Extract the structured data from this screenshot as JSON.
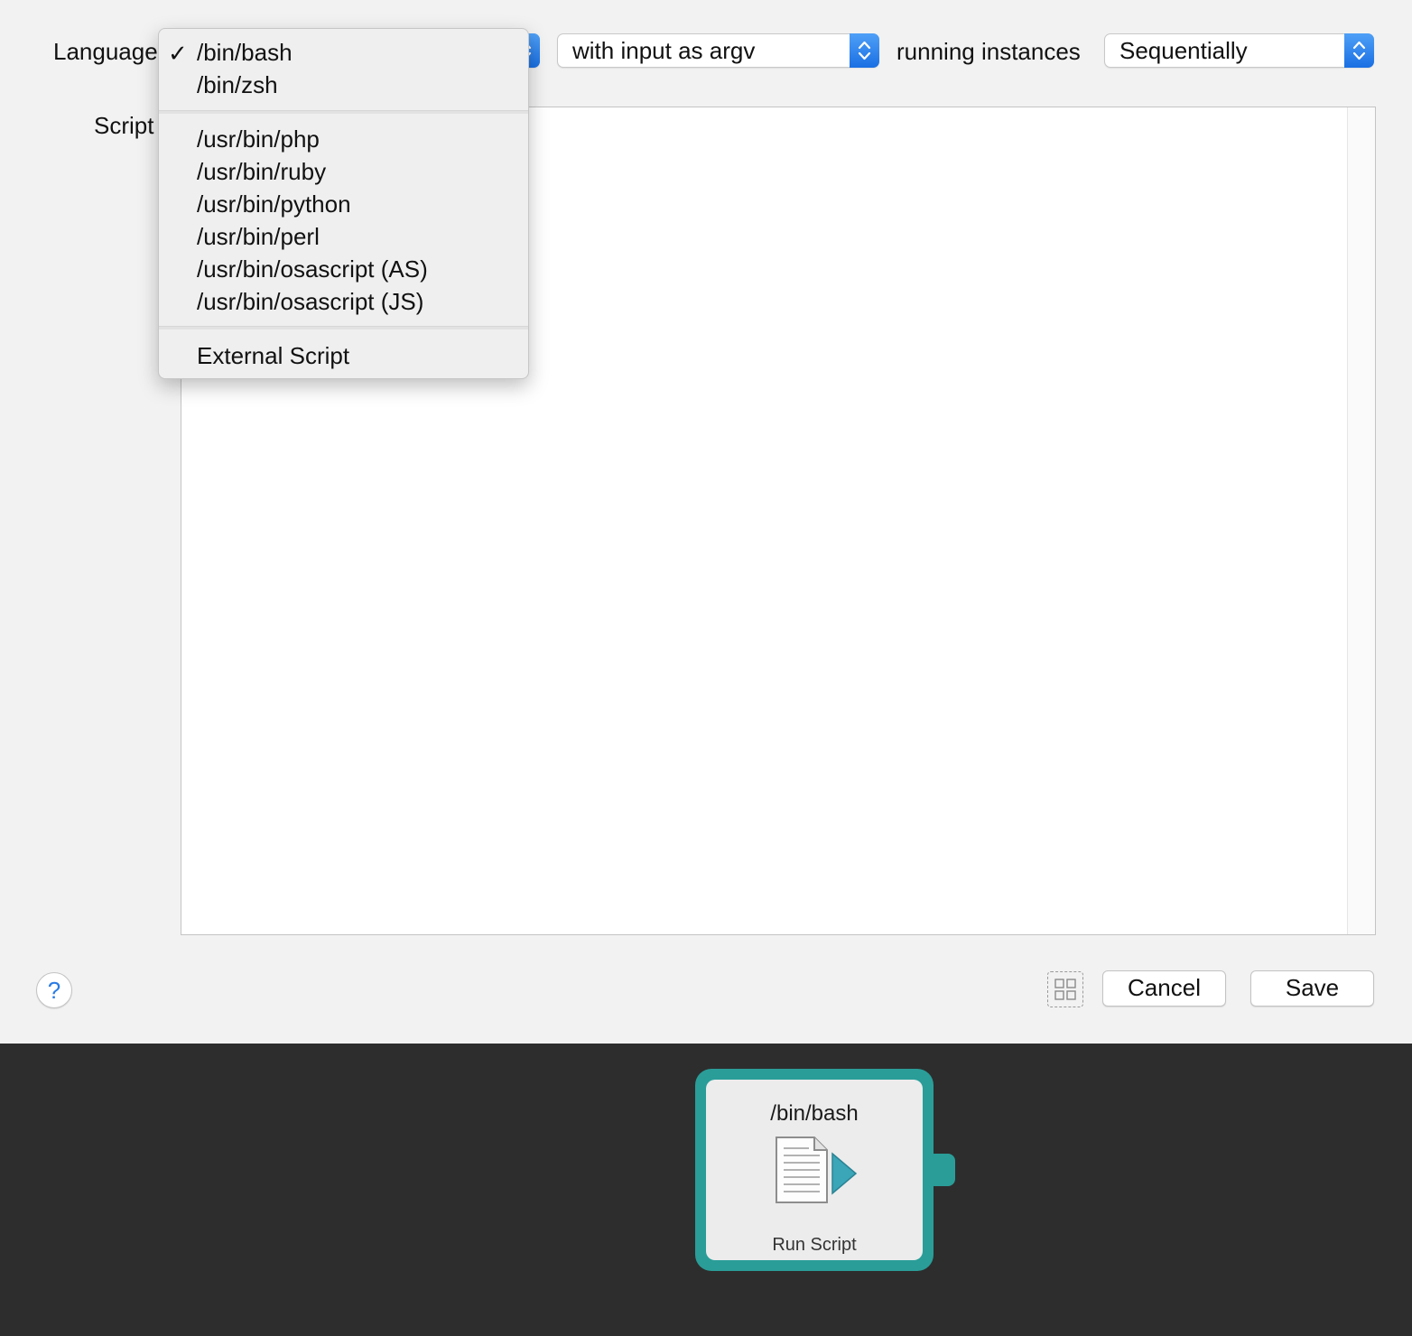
{
  "form": {
    "language_label": "Language",
    "script_label": "Script",
    "input_popup_value": "with input as argv",
    "running_label": "running instances",
    "running_popup_value": "Sequentially"
  },
  "language_menu": {
    "selected_check": "✓",
    "items": [
      "/bin/bash",
      "/bin/zsh",
      "/usr/bin/php",
      "/usr/bin/ruby",
      "/usr/bin/python",
      "/usr/bin/perl",
      "/usr/bin/osascript (AS)",
      "/usr/bin/osascript (JS)",
      "External Script"
    ]
  },
  "footer": {
    "help_symbol": "?",
    "cancel_label": "Cancel",
    "save_label": "Save"
  },
  "node": {
    "title": "/bin/bash",
    "label": "Run Script",
    "icon": "script-document-icon",
    "color": "#2a9d98"
  },
  "colors": {
    "accent": "#1a6fe3",
    "panel_bg": "#f2f2f2",
    "canvas_bg": "#2d2d2d"
  }
}
